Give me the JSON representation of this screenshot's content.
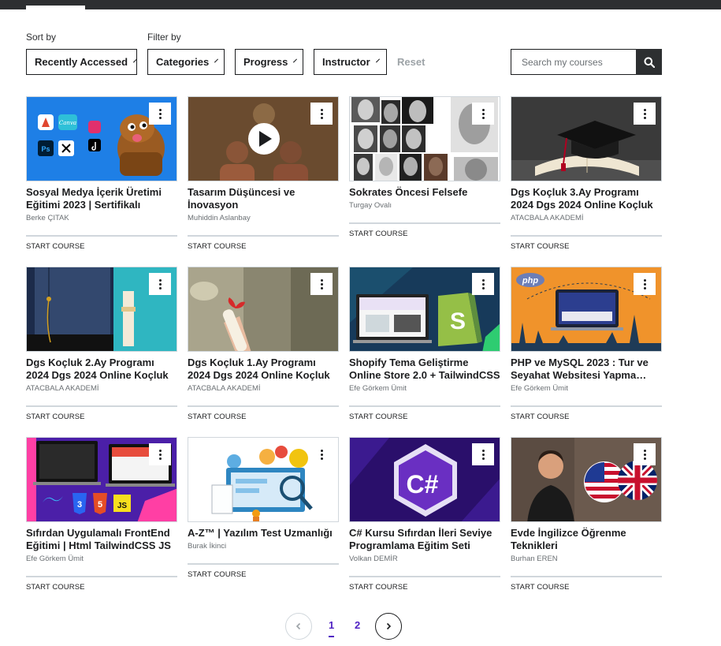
{
  "filters": {
    "sort_label": "Sort by",
    "filter_label": "Filter by",
    "sort_value": "Recently Accessed",
    "categories": "Categories",
    "progress": "Progress",
    "instructor": "Instructor",
    "reset": "Reset",
    "search_placeholder": "Search my courses"
  },
  "courses": [
    {
      "title": "Sosyal Medya İçerik Üretimi Eğitimi 2023 | Sertifikalı",
      "instructor": "Berke ÇITAK",
      "action": "START COURSE"
    },
    {
      "title": "Tasarım Düşüncesi ve İnovasyon",
      "instructor": "Muhiddin Aslanbay",
      "action": "START COURSE"
    },
    {
      "title": "Sokrates Öncesi Felsefe",
      "instructor": "Turgay Ovalı",
      "action": "START COURSE"
    },
    {
      "title": "Dgs Koçluk 3.Ay Programı 2024 Dgs 2024 Online Koçluk",
      "instructor": "ATACBALA AKADEMİ",
      "action": "START COURSE"
    },
    {
      "title": "Dgs Koçluk 2.Ay Programı 2024 Dgs 2024 Online Koçluk",
      "instructor": "ATACBALA AKADEMİ",
      "action": "START COURSE"
    },
    {
      "title": "Dgs Koçluk 1.Ay Programı 2024 Dgs 2024 Online Koçluk",
      "instructor": "ATACBALA AKADEMİ",
      "action": "START COURSE"
    },
    {
      "title": "Shopify Tema Geliştirme Online Store 2.0 + TailwindCSS",
      "instructor": "Efe Görkem Ümit",
      "action": "START COURSE"
    },
    {
      "title": "PHP ve MySQL 2023 : Tur ve Seyahat Websitesi Yapma…",
      "instructor": "Efe Görkem Ümit",
      "action": "START COURSE"
    },
    {
      "title": "Sıfırdan Uygulamalı FrontEnd Eğitimi | Html TailwindCSS JS",
      "instructor": "Efe Görkem Ümit",
      "action": "START COURSE"
    },
    {
      "title": "A-Z™ | Yazılım Test Uzmanlığı",
      "instructor": "Burak İkinci",
      "action": "START COURSE"
    },
    {
      "title": "C# Kursu Sıfırdan İleri Seviye Programlama Eğitim Seti",
      "instructor": "Volkan DEMİR",
      "action": "START COURSE"
    },
    {
      "title": "Evde İngilizce Öğrenme Teknikleri",
      "instructor": "Burhan EREN",
      "action": "START COURSE"
    }
  ],
  "thumb_text": {
    "canva": "Canva",
    "php": "php",
    "html": "5",
    "css": "3",
    "js": "JS",
    "csharp": "C#",
    "ps": "Ps"
  },
  "pagination": {
    "pages": [
      "1",
      "2"
    ],
    "current": "1"
  },
  "colors": {
    "accent": "#5022c3",
    "dark": "#2d2f31",
    "border": "#d1d7dc"
  }
}
